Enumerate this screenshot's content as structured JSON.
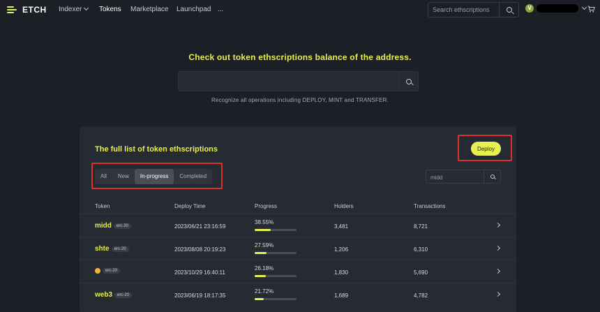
{
  "nav": {
    "brand": "ETCH",
    "items": [
      {
        "label": "Indexer",
        "dropdown": true
      },
      {
        "label": "Tokens",
        "active": true
      },
      {
        "label": "Marketplace"
      },
      {
        "label": "Launchpad"
      },
      {
        "label": "..."
      }
    ],
    "search_placeholder": "Search ethscriptions",
    "user_initial": "V",
    "accent": "#e6f050"
  },
  "hero": {
    "title": "Check out token ethscriptions balance of the address.",
    "search_value": "",
    "hint": "Recognize all operations including DEPLOY, MINT and TRANSFER."
  },
  "card": {
    "title": "The full list of token ethscriptions",
    "deploy_label": "Deploy",
    "tabs": [
      "All",
      "New",
      "In-progress",
      "Completed"
    ],
    "active_tab": "In-progress",
    "filter_value": "midd",
    "columns": [
      "Token",
      "Deploy Time",
      "Progress",
      "Holders",
      "Transactions"
    ],
    "rows": [
      {
        "token": "midd",
        "badge": "erc-20",
        "deploy_time": "2023/06/21 23:16:59",
        "progress": "38.55%",
        "progress_value": 0.3855,
        "holders": "3,481",
        "transactions": "8,721"
      },
      {
        "token": "shte",
        "badge": "erc-20",
        "deploy_time": "2023/08/08 20:19:23",
        "progress": "27.59%",
        "progress_value": 0.2759,
        "holders": "1,206",
        "transactions": "6,310"
      },
      {
        "token": "",
        "emoji_icon": "smiley-emoji",
        "badge": "erc-20",
        "deploy_time": "2023/10/29 16:40:11",
        "progress": "26.18%",
        "progress_value": 0.2618,
        "holders": "1,830",
        "transactions": "5,690"
      },
      {
        "token": "web3",
        "badge": "erc-20",
        "deploy_time": "2023/06/19 18:17:35",
        "progress": "21.72%",
        "progress_value": 0.2172,
        "holders": "1,689",
        "transactions": "4,782"
      }
    ]
  }
}
